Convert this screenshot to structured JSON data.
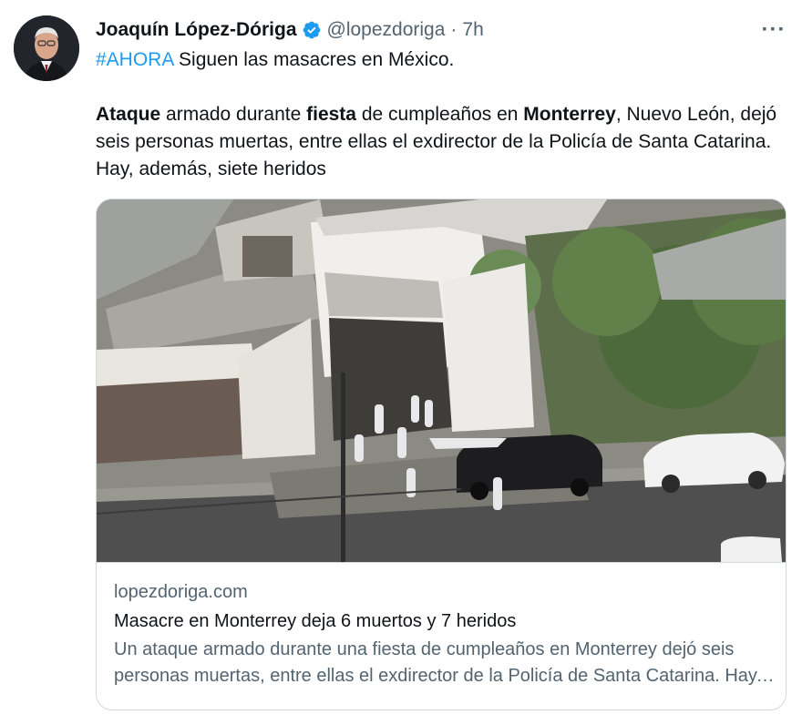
{
  "author": {
    "name": "Joaquín López-Dóriga",
    "handle": "@lopezdoriga",
    "separator": "·",
    "time": "7h",
    "verified_icon": "verified-badge-icon",
    "verified_color": "#1d9bf0"
  },
  "menu": {
    "more_label": "···"
  },
  "tweet": {
    "hashtag": "#AHORA",
    "line1_rest": " Siguen las masacres en México.",
    "p2": {
      "w1": "Ataque",
      "t1": " armado durante ",
      "w2": "fiesta",
      "t2": " de cumpleaños en ",
      "w3": "Monterrey",
      "t3": ", Nuevo León, dejó seis personas muertas, entre ellas el exdirector de la Policía de Santa Catarina. Hay, además, siete heridos"
    }
  },
  "card": {
    "domain": "lopezdoriga.com",
    "title": "Masacre en Monterrey deja 6 muertos y 7 heridos",
    "description": "Un ataque armado durante una fiesta de cumpleaños en Monterrey dejó seis personas muertas, entre ellas el exdirector de la Policía de Santa Catarina. Hay, además, siete heridos"
  },
  "colors": {
    "text": "#0f1419",
    "secondary": "#536471",
    "link": "#1d9bf0",
    "border": "#cfd9de"
  }
}
